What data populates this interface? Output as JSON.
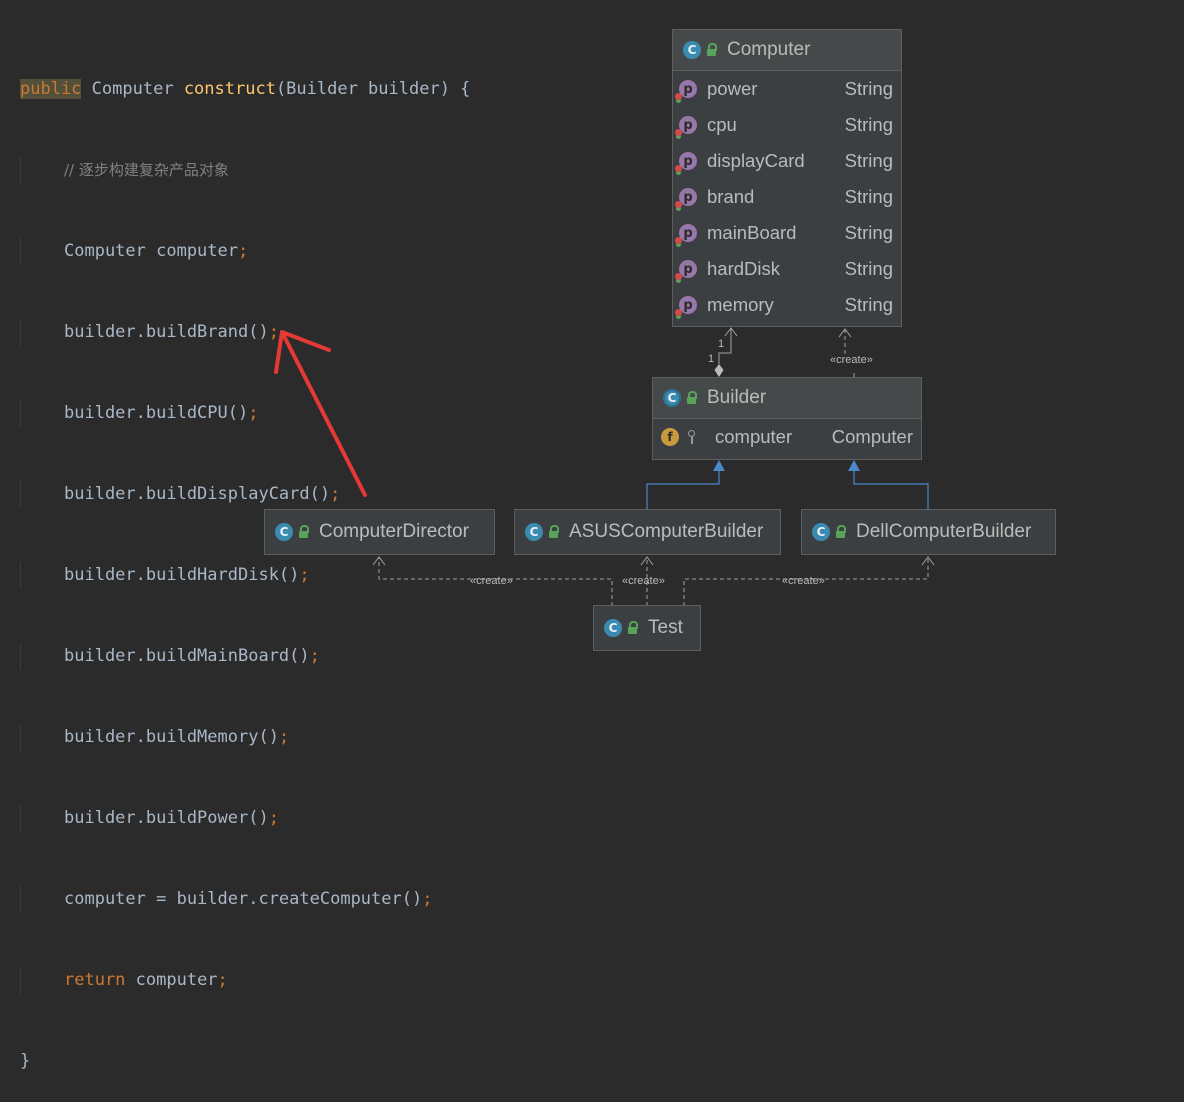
{
  "code": {
    "line1": {
      "kw": "public",
      "type": "Computer",
      "method": "construct",
      "params": "(Builder builder) {"
    },
    "comment": "// 逐步构建复杂产品对象",
    "decl": {
      "text": "Computer computer",
      "semi": ";"
    },
    "calls": [
      {
        "text": "builder.buildBrand()",
        "semi": ";"
      },
      {
        "text": "builder.buildCPU()",
        "semi": ";"
      },
      {
        "text": "builder.buildDisplayCard()",
        "semi": ";"
      },
      {
        "text": "builder.buildHardDisk()",
        "semi": ";"
      },
      {
        "text": "builder.buildMainBoard()",
        "semi": ";"
      },
      {
        "text": "builder.buildMemory()",
        "semi": ";"
      },
      {
        "text": "builder.buildPower()",
        "semi": ";"
      },
      {
        "text": "computer = builder.createComputer()",
        "semi": ";"
      }
    ],
    "ret": {
      "kw": "return",
      "text": " computer",
      "semi": ";"
    },
    "close": "}"
  },
  "uml": {
    "computer": {
      "name": "Computer",
      "fields": [
        {
          "name": "power",
          "type": "String"
        },
        {
          "name": "cpu",
          "type": "String"
        },
        {
          "name": "displayCard",
          "type": "String"
        },
        {
          "name": "brand",
          "type": "String"
        },
        {
          "name": "mainBoard",
          "type": "String"
        },
        {
          "name": "hardDisk",
          "type": "String"
        },
        {
          "name": "memory",
          "type": "String"
        }
      ]
    },
    "builder": {
      "name": "Builder",
      "field": {
        "name": "computer",
        "type": "Computer"
      }
    },
    "director": {
      "name": "ComputerDirector"
    },
    "asus": {
      "name": "ASUSComputerBuilder"
    },
    "dell": {
      "name": "DellComputerBuilder"
    },
    "test": {
      "name": "Test"
    },
    "labels": {
      "create": "«create»",
      "mult_top": "1",
      "mult_bottom": "1"
    },
    "icons": {
      "class": "C",
      "property": "p",
      "field": "f"
    }
  },
  "colors": {
    "arrow": "#e53935",
    "inherit": "#4a88c7",
    "dep": "#a0a0a0"
  }
}
